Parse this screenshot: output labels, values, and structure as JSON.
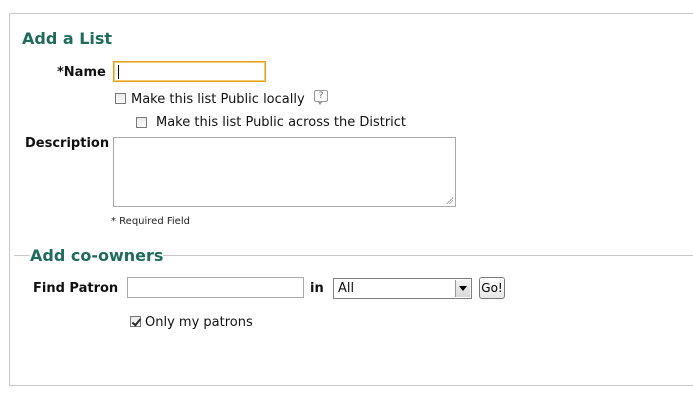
{
  "add_list": {
    "title": "Add a List",
    "name_label": "*Name",
    "name_value": "",
    "public_local_label": "Make this list Public locally",
    "public_local_checked": false,
    "help_icon": "help-speech-bubble-icon",
    "help_icon_glyph": "?",
    "public_district_label": "Make this list Public across the District",
    "public_district_checked": false,
    "description_label": "Description",
    "description_value": "",
    "required_note": "* Required Field"
  },
  "co_owners": {
    "title": "Add co-owners",
    "find_patron_label": "Find Patron",
    "find_patron_value": "",
    "in_label": "in",
    "scope_selected": "All",
    "go_label": "Go!",
    "only_my_patrons_label": "Only my patrons",
    "only_my_patrons_checked": true
  },
  "colors": {
    "heading": "#1f6b5c",
    "focus_border": "#e3a21a",
    "panel_border": "#c8c8c8"
  }
}
